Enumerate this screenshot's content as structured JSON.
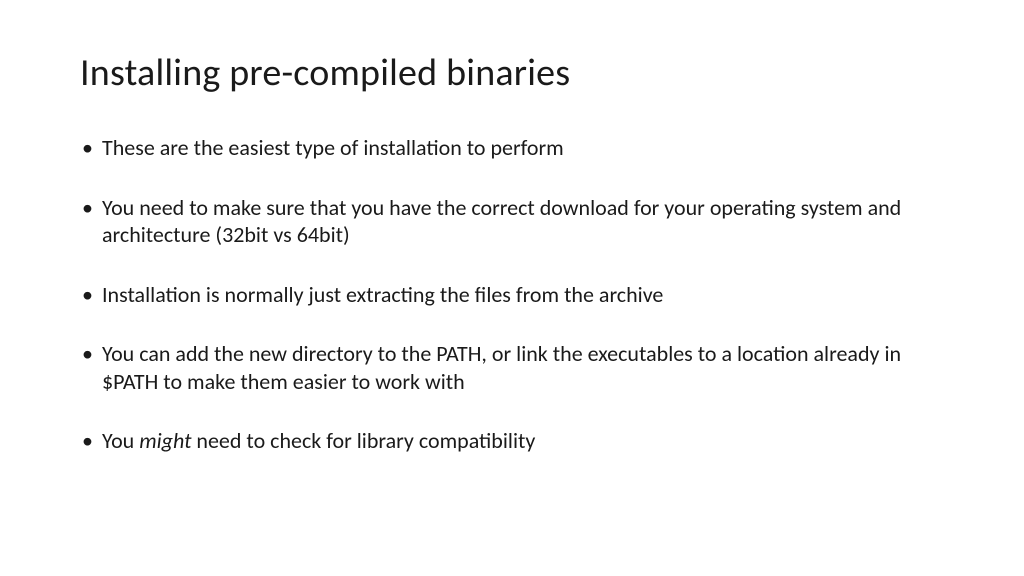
{
  "slide": {
    "title": "Installing pre-compiled binaries",
    "bullets": [
      {
        "text": "These are the easiest type of installation to perform"
      },
      {
        "text": "You need to make sure that you have the correct download for your operating system and architecture (32bit vs 64bit)"
      },
      {
        "text": "Installation is normally just extracting the files from the archive"
      },
      {
        "text": "You can add the new directory to the PATH, or link the executables to a location already in $PATH to make them easier to work with"
      },
      {
        "pre": "You ",
        "italic": "might",
        "post": " need to check for library compatibility"
      }
    ]
  }
}
